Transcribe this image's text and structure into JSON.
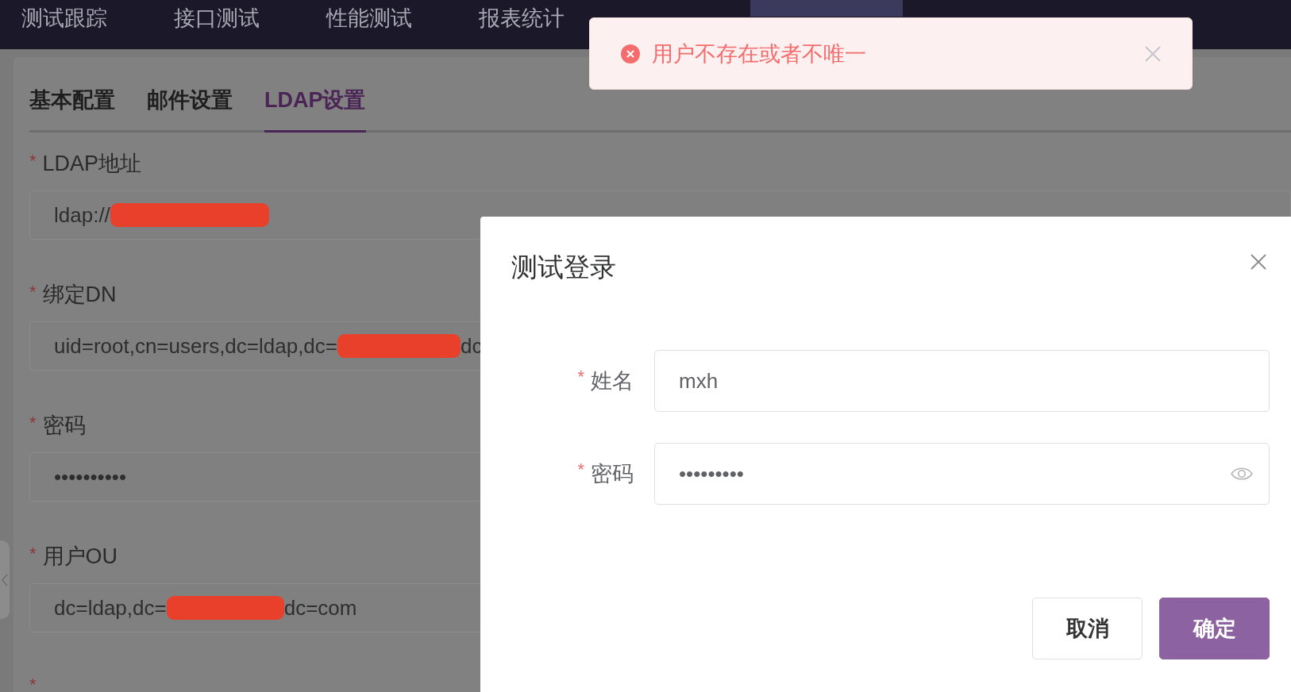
{
  "top_nav": {
    "items": [
      {
        "label": "测试跟踪",
        "selected": false
      },
      {
        "label": "接口测试",
        "selected": false
      },
      {
        "label": "性能测试",
        "selected": false
      },
      {
        "label": "报表统计",
        "selected": false
      },
      {
        "selected": false
      },
      {
        "selected": true
      }
    ]
  },
  "settings": {
    "tabs": [
      {
        "label": "基本配置",
        "selected": false
      },
      {
        "label": "邮件设置",
        "selected": false
      },
      {
        "label": "LDAP设置",
        "selected": true
      }
    ],
    "fields": [
      {
        "label": "LDAP地址",
        "required_mark": "*",
        "value_parts": [
          {
            "kind": "text",
            "text": "ldap://"
          },
          {
            "kind": "redaction"
          }
        ]
      },
      {
        "label": "绑定DN",
        "required_mark": "*",
        "value_parts": [
          {
            "kind": "text",
            "text": "uid=root,cn=users,dc=ldap,dc="
          },
          {
            "kind": "redaction"
          },
          {
            "kind": "text",
            "text": "dc"
          }
        ]
      },
      {
        "label": "密码",
        "required_mark": "*",
        "value_parts": [
          {
            "kind": "text",
            "text": "••••••••••"
          }
        ]
      },
      {
        "label": "用户OU",
        "required_mark": "*",
        "value_parts": [
          {
            "kind": "text",
            "text": "dc=ldap,dc="
          },
          {
            "kind": "redaction"
          },
          {
            "kind": "text",
            "text": "dc=com"
          }
        ]
      },
      {
        "required_mark": "*"
      }
    ]
  },
  "dialog": {
    "title": "测试登录",
    "fields": [
      {
        "label": "姓名",
        "required_mark": "*",
        "kind": "text",
        "value": "mxh"
      },
      {
        "label": "密码",
        "required_mark": "*",
        "kind": "password",
        "value": "•••••••••"
      }
    ],
    "buttons": [
      {
        "label": "取消",
        "kind": "secondary"
      },
      {
        "label": "确定",
        "kind": "primary"
      }
    ]
  },
  "toast": {
    "message": "用户不存在或者不唯一"
  }
}
